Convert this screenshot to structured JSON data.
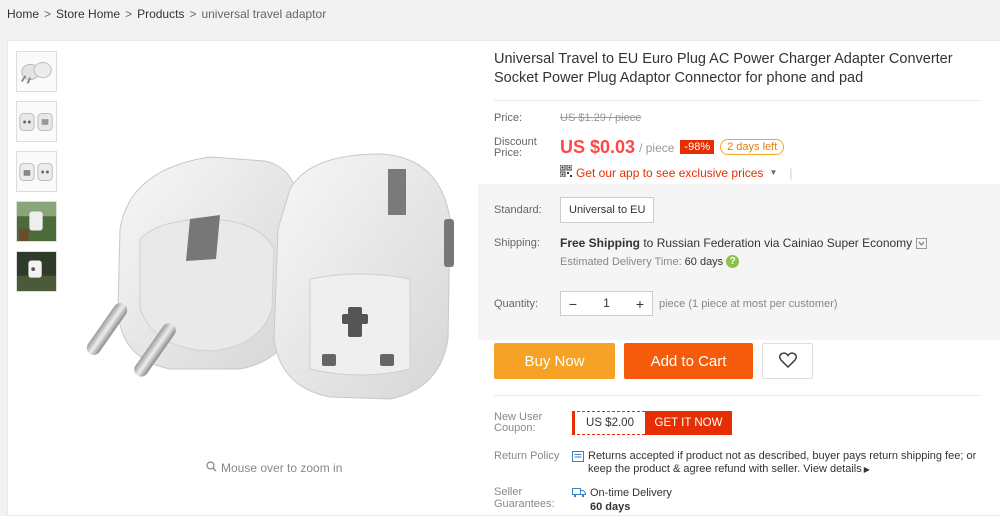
{
  "breadcrumb": {
    "items": [
      "Home",
      "Store Home",
      "Products"
    ],
    "current": "universal travel adaptor",
    "separator": ">"
  },
  "gallery": {
    "thumbnails": [
      "plug-pair-small",
      "plug-front-back",
      "plug-socket-view",
      "plug-outdoor-photo",
      "plug-dark-photo"
    ],
    "zoom_hint": "Mouse over to zoom in"
  },
  "product": {
    "title": "Universal Travel to EU Euro Plug AC Power Charger Adapter Converter Socket Power Plug Adaptor Connector for phone and pad",
    "price_label": "Price:",
    "original_price": "US $1.29 / piece",
    "discount_label_1": "Discount",
    "discount_label_2": "Price:",
    "current_price": "US $0.03",
    "per_unit": "/ piece",
    "discount_pct": "-98%",
    "time_left": "2 days left",
    "app_promo": "Get our app to see exclusive prices",
    "standard_label": "Standard:",
    "standard_option": "Universal to EU",
    "shipping_label": "Shipping:",
    "shipping_free": "Free Shipping",
    "shipping_rest": " to Russian Federation via Cainiao Super Economy",
    "est_label": "Estimated Delivery Time:",
    "est_days": "60 days",
    "quantity_label": "Quantity:",
    "quantity_value": "1",
    "quantity_note": "piece (1 piece at most per customer)",
    "buy_now": "Buy Now",
    "add_to_cart": "Add to Cart",
    "coupon_label_1": "New User",
    "coupon_label_2": "Coupon:",
    "coupon_value": "US $2.00",
    "coupon_action": "GET IT NOW",
    "return_label": "Return Policy",
    "return_text": "Returns accepted if product not as described, buyer pays return shipping fee; or keep the product & agree refund with seller.",
    "return_link": "View details",
    "guarantee_label_1": "Seller",
    "guarantee_label_2": "Guarantees:",
    "guarantee_text": "On-time Delivery",
    "guarantee_days": "60 days"
  },
  "colors": {
    "price_red": "#ff4747",
    "buy_now_orange": "#f5a227",
    "add_cart_orange": "#f45b0b",
    "coupon_red": "#e62e04"
  }
}
